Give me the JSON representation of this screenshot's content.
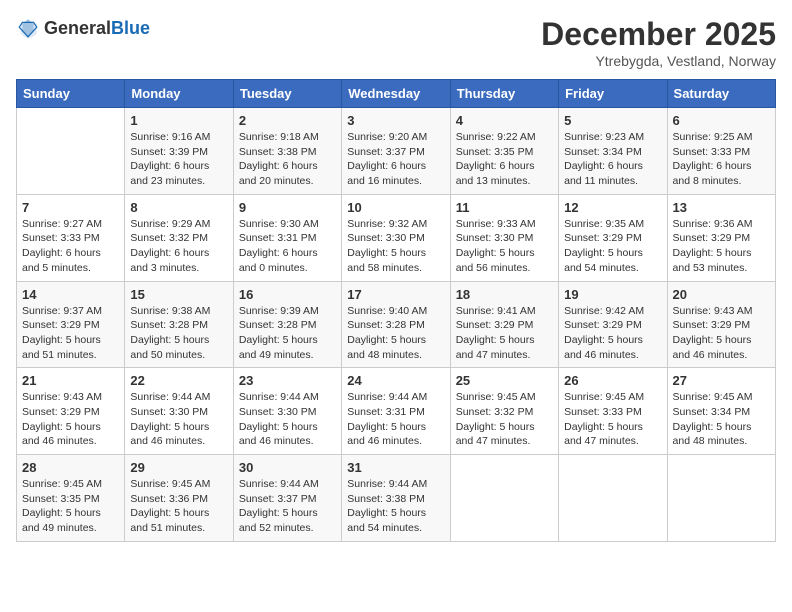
{
  "logo": {
    "general": "General",
    "blue": "Blue"
  },
  "title": "December 2025",
  "subtitle": "Ytrebygda, Vestland, Norway",
  "header_days": [
    "Sunday",
    "Monday",
    "Tuesday",
    "Wednesday",
    "Thursday",
    "Friday",
    "Saturday"
  ],
  "weeks": [
    [
      {
        "day": "",
        "info": ""
      },
      {
        "day": "1",
        "info": "Sunrise: 9:16 AM\nSunset: 3:39 PM\nDaylight: 6 hours\nand 23 minutes."
      },
      {
        "day": "2",
        "info": "Sunrise: 9:18 AM\nSunset: 3:38 PM\nDaylight: 6 hours\nand 20 minutes."
      },
      {
        "day": "3",
        "info": "Sunrise: 9:20 AM\nSunset: 3:37 PM\nDaylight: 6 hours\nand 16 minutes."
      },
      {
        "day": "4",
        "info": "Sunrise: 9:22 AM\nSunset: 3:35 PM\nDaylight: 6 hours\nand 13 minutes."
      },
      {
        "day": "5",
        "info": "Sunrise: 9:23 AM\nSunset: 3:34 PM\nDaylight: 6 hours\nand 11 minutes."
      },
      {
        "day": "6",
        "info": "Sunrise: 9:25 AM\nSunset: 3:33 PM\nDaylight: 6 hours\nand 8 minutes."
      }
    ],
    [
      {
        "day": "7",
        "info": "Sunrise: 9:27 AM\nSunset: 3:33 PM\nDaylight: 6 hours\nand 5 minutes."
      },
      {
        "day": "8",
        "info": "Sunrise: 9:29 AM\nSunset: 3:32 PM\nDaylight: 6 hours\nand 3 minutes."
      },
      {
        "day": "9",
        "info": "Sunrise: 9:30 AM\nSunset: 3:31 PM\nDaylight: 6 hours\nand 0 minutes."
      },
      {
        "day": "10",
        "info": "Sunrise: 9:32 AM\nSunset: 3:30 PM\nDaylight: 5 hours\nand 58 minutes."
      },
      {
        "day": "11",
        "info": "Sunrise: 9:33 AM\nSunset: 3:30 PM\nDaylight: 5 hours\nand 56 minutes."
      },
      {
        "day": "12",
        "info": "Sunrise: 9:35 AM\nSunset: 3:29 PM\nDaylight: 5 hours\nand 54 minutes."
      },
      {
        "day": "13",
        "info": "Sunrise: 9:36 AM\nSunset: 3:29 PM\nDaylight: 5 hours\nand 53 minutes."
      }
    ],
    [
      {
        "day": "14",
        "info": "Sunrise: 9:37 AM\nSunset: 3:29 PM\nDaylight: 5 hours\nand 51 minutes."
      },
      {
        "day": "15",
        "info": "Sunrise: 9:38 AM\nSunset: 3:28 PM\nDaylight: 5 hours\nand 50 minutes."
      },
      {
        "day": "16",
        "info": "Sunrise: 9:39 AM\nSunset: 3:28 PM\nDaylight: 5 hours\nand 49 minutes."
      },
      {
        "day": "17",
        "info": "Sunrise: 9:40 AM\nSunset: 3:28 PM\nDaylight: 5 hours\nand 48 minutes."
      },
      {
        "day": "18",
        "info": "Sunrise: 9:41 AM\nSunset: 3:29 PM\nDaylight: 5 hours\nand 47 minutes."
      },
      {
        "day": "19",
        "info": "Sunrise: 9:42 AM\nSunset: 3:29 PM\nDaylight: 5 hours\nand 46 minutes."
      },
      {
        "day": "20",
        "info": "Sunrise: 9:43 AM\nSunset: 3:29 PM\nDaylight: 5 hours\nand 46 minutes."
      }
    ],
    [
      {
        "day": "21",
        "info": "Sunrise: 9:43 AM\nSunset: 3:29 PM\nDaylight: 5 hours\nand 46 minutes."
      },
      {
        "day": "22",
        "info": "Sunrise: 9:44 AM\nSunset: 3:30 PM\nDaylight: 5 hours\nand 46 minutes."
      },
      {
        "day": "23",
        "info": "Sunrise: 9:44 AM\nSunset: 3:30 PM\nDaylight: 5 hours\nand 46 minutes."
      },
      {
        "day": "24",
        "info": "Sunrise: 9:44 AM\nSunset: 3:31 PM\nDaylight: 5 hours\nand 46 minutes."
      },
      {
        "day": "25",
        "info": "Sunrise: 9:45 AM\nSunset: 3:32 PM\nDaylight: 5 hours\nand 47 minutes."
      },
      {
        "day": "26",
        "info": "Sunrise: 9:45 AM\nSunset: 3:33 PM\nDaylight: 5 hours\nand 47 minutes."
      },
      {
        "day": "27",
        "info": "Sunrise: 9:45 AM\nSunset: 3:34 PM\nDaylight: 5 hours\nand 48 minutes."
      }
    ],
    [
      {
        "day": "28",
        "info": "Sunrise: 9:45 AM\nSunset: 3:35 PM\nDaylight: 5 hours\nand 49 minutes."
      },
      {
        "day": "29",
        "info": "Sunrise: 9:45 AM\nSunset: 3:36 PM\nDaylight: 5 hours\nand 51 minutes."
      },
      {
        "day": "30",
        "info": "Sunrise: 9:44 AM\nSunset: 3:37 PM\nDaylight: 5 hours\nand 52 minutes."
      },
      {
        "day": "31",
        "info": "Sunrise: 9:44 AM\nSunset: 3:38 PM\nDaylight: 5 hours\nand 54 minutes."
      },
      {
        "day": "",
        "info": ""
      },
      {
        "day": "",
        "info": ""
      },
      {
        "day": "",
        "info": ""
      }
    ]
  ]
}
